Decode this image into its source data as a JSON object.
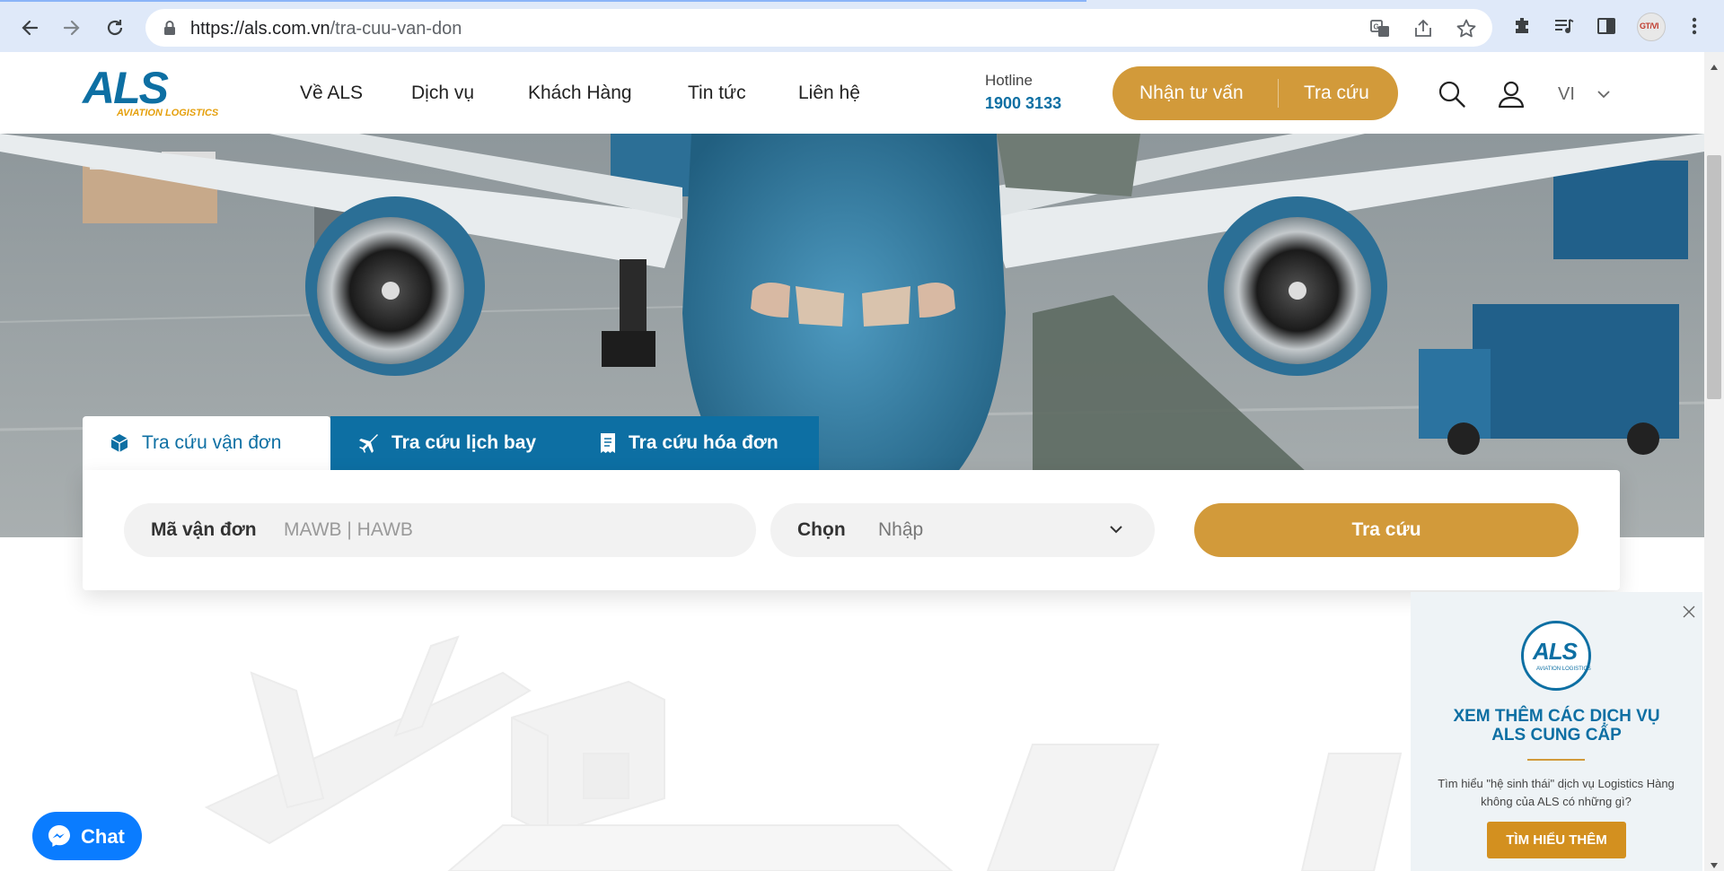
{
  "browser": {
    "url_host": "https://als.com.vn",
    "url_path": "/tra-cuu-van-don",
    "avatar_text": "GT/VI",
    "icons": [
      "back-arrow-icon",
      "forward-arrow-icon",
      "reload-icon",
      "lock-icon",
      "translate-icon",
      "share-icon",
      "star-icon",
      "extensions-icon",
      "media-icon",
      "side-panel-icon",
      "profile-avatar",
      "more-icon"
    ]
  },
  "header": {
    "logo_text": "ALS",
    "logo_sub": "AVIATION LOGISTICS",
    "nav": [
      "Về ALS",
      "Dịch vụ",
      "Khách Hàng",
      "Tin tức",
      "Liên hệ"
    ],
    "hotline_label": "Hotline",
    "hotline_number": "1900 3133",
    "consult_label": "Nhận tư vấn",
    "lookup_label": "Tra cứu",
    "lang": "VI"
  },
  "tabs": [
    {
      "label": "Tra cứu vận đơn",
      "icon": "package-icon",
      "active": true
    },
    {
      "label": "Tra cứu lịch bay",
      "icon": "plane-icon",
      "active": false
    },
    {
      "label": "Tra cứu hóa đơn",
      "icon": "receipt-icon",
      "active": false
    }
  ],
  "search": {
    "awb_label": "Mã vận đơn",
    "awb_placeholder": "MAWB | HAWB",
    "select_label": "Chọn",
    "select_value": "Nhập",
    "submit_label": "Tra cứu"
  },
  "popup": {
    "logo_text": "ALS",
    "logo_sub": "AVIATION LOGISTICS",
    "title_line1": "XEM THÊM CÁC DỊCH VỤ",
    "title_line2": "ALS CUNG CẤP",
    "desc": "Tìm hiểu \"hệ sinh thái\" dịch vụ Logistics Hàng không của ALS có những gì?",
    "button_label": "TÌM HIỂU THÊM"
  },
  "chat": {
    "label": "Chat"
  },
  "colors": {
    "brand_blue": "#0d6fa3",
    "brand_gold": "#d29a3a",
    "messenger_blue": "#0a7cff"
  }
}
